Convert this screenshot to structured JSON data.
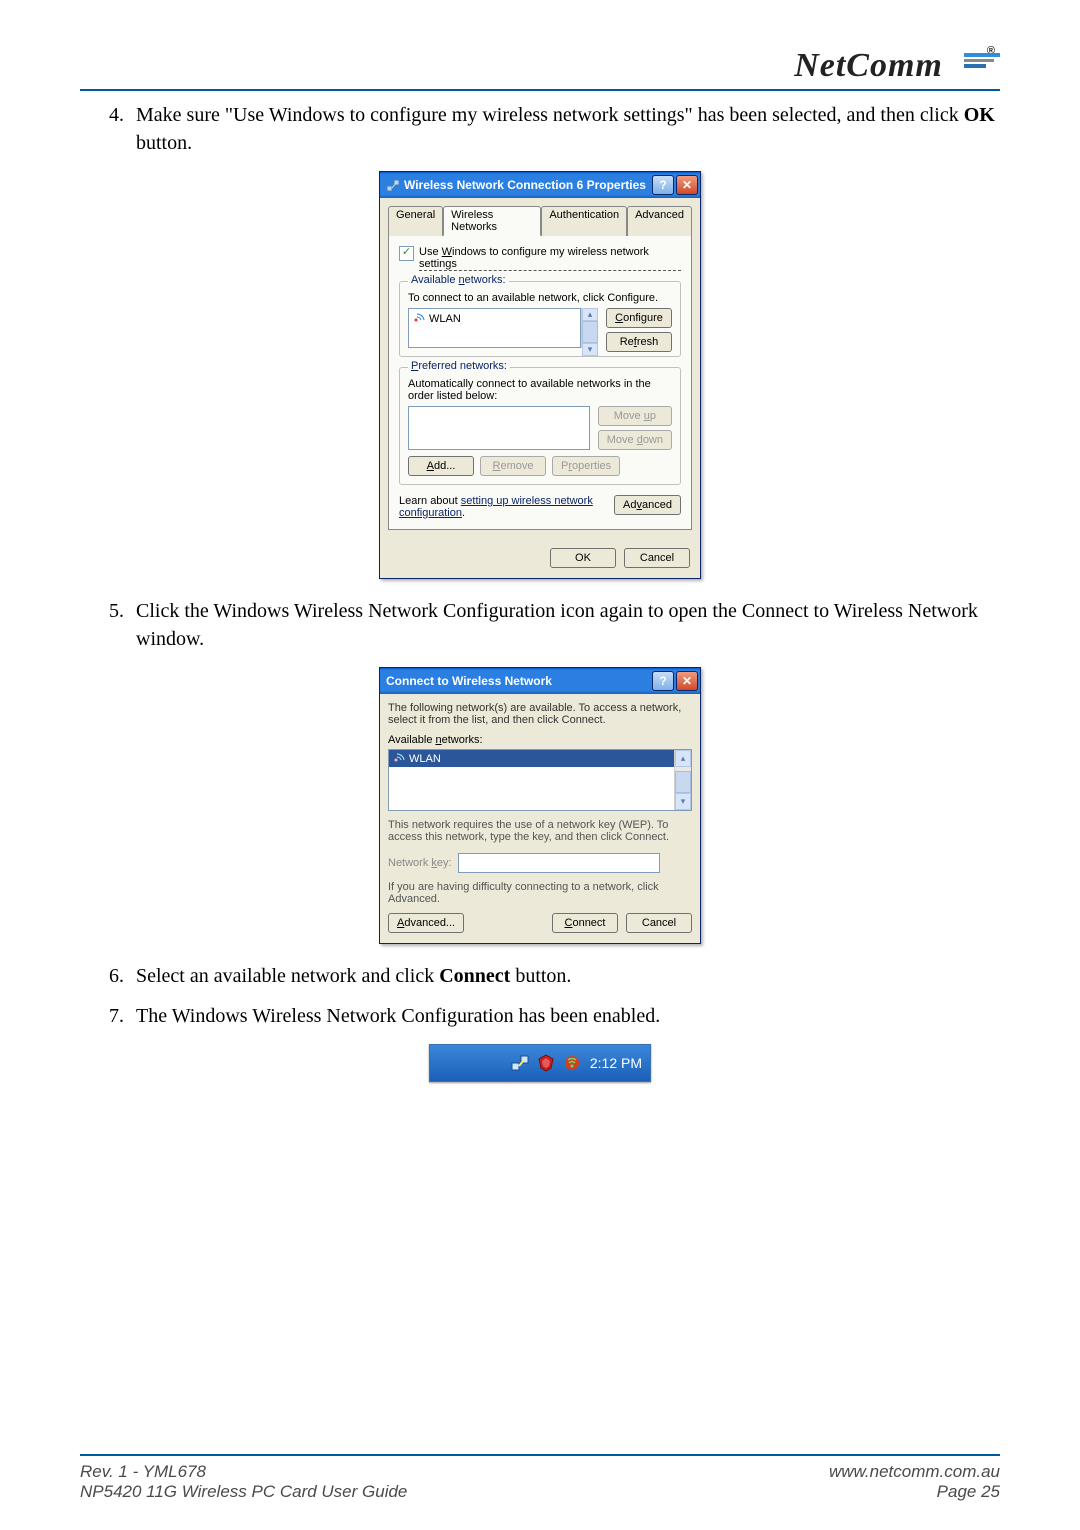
{
  "brand": "NetComm",
  "steps": {
    "s4": {
      "num": "4.",
      "text_a": "Make sure \"Use Windows to configure my wireless network settings\" has been selected, and then click ",
      "bold": "OK",
      "text_b": " button."
    },
    "s5": {
      "num": "5.",
      "text": "Click the Windows Wireless Network Configuration icon again to open the Connect to Wireless Network window."
    },
    "s6": {
      "num": "6.",
      "text_a": "Select an available network and click ",
      "bold": "Connect",
      "text_b": " button."
    },
    "s7": {
      "num": "7.",
      "text": "The Windows Wireless Network Configuration has been enabled."
    }
  },
  "dlg1": {
    "title": "Wireless Network Connection 6 Properties",
    "tabs": {
      "general": "General",
      "wireless": "Wireless Networks",
      "auth": "Authentication",
      "adv": "Advanced"
    },
    "checkbox_label_pre": "Use ",
    "checkbox_label_u": "W",
    "checkbox_label_post": "indows to configure my wireless network settings",
    "available_legend_pre": "Available ",
    "available_legend_u": "n",
    "available_legend_post": "etworks:",
    "available_desc": "To connect to an available network, click Configure.",
    "available_network": "WLAN",
    "configure_pre": "",
    "configure_u": "C",
    "configure_post": "onfigure",
    "refresh_pre": "Re",
    "refresh_u": "f",
    "refresh_post": "resh",
    "preferred_legend_pre": "",
    "preferred_legend_u": "P",
    "preferred_legend_post": "referred networks:",
    "preferred_desc": "Automatically connect to available networks in the order listed below:",
    "moveup_pre": "Move ",
    "moveup_u": "u",
    "moveup_post": "p",
    "movedown_pre": "Move ",
    "movedown_u": "d",
    "movedown_post": "own",
    "add_pre": "",
    "add_u": "A",
    "add_post": "dd...",
    "remove_pre": "",
    "remove_u": "R",
    "remove_post": "emove",
    "props_pre": "P",
    "props_u": "r",
    "props_post": "operties",
    "learn_text": "Learn about ",
    "learn_link": "setting up wireless network configuration",
    "advanced_pre": "Ad",
    "advanced_u": "v",
    "advanced_post": "anced",
    "ok": "OK",
    "cancel": "Cancel"
  },
  "dlg2": {
    "title": "Connect to Wireless Network",
    "intro": "The following network(s) are available. To access a network, select it from the list, and then click Connect.",
    "available_label_pre": "Available ",
    "available_label_u": "n",
    "available_label_post": "etworks:",
    "selected": "WLAN",
    "wep_text": "This network requires the use of a network key (WEP). To access this network, type the key, and then click Connect.",
    "netkey_label_pre": "Network ",
    "netkey_label_u": "k",
    "netkey_label_post": "ey:",
    "trouble": "If you are having difficulty connecting to a network, click Advanced.",
    "advanced_pre": "",
    "advanced_u": "A",
    "advanced_post": "dvanced...",
    "connect_pre": "",
    "connect_u": "C",
    "connect_post": "onnect",
    "cancel": "Cancel"
  },
  "tray_time": "2:12 PM",
  "footer": {
    "left_a": "Rev. 1 - YML678",
    "left_b": "NP5420 11G Wireless PC Card User Guide",
    "right_a": "www.netcomm.com.au",
    "right_b": "Page 25"
  }
}
